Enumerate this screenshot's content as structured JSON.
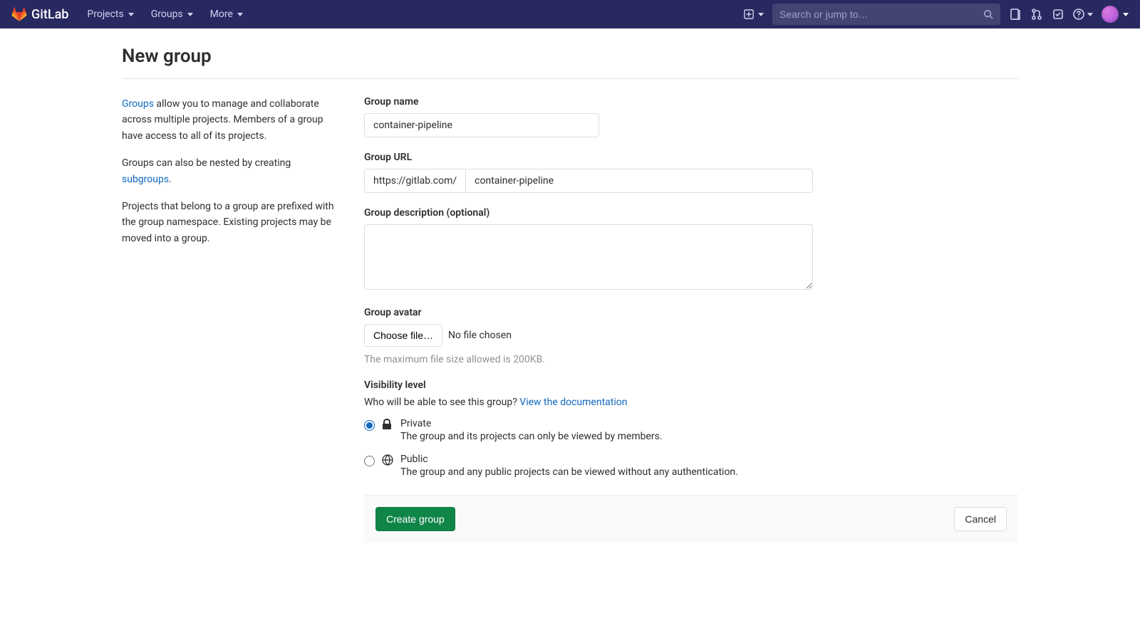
{
  "brand": {
    "name": "GitLab"
  },
  "nav": {
    "projects": "Projects",
    "groups": "Groups",
    "more": "More",
    "search_placeholder": "Search or jump to…"
  },
  "page": {
    "title": "New group"
  },
  "info": {
    "p1_link": "Groups",
    "p1_rest": " allow you to manage and collaborate across multiple projects. Members of a group have access to all of its projects.",
    "p2_prefix": "Groups can also be nested by creating ",
    "p2_link": "subgroups",
    "p2_suffix": ".",
    "p3": "Projects that belong to a group are prefixed with the group namespace. Existing projects may be moved into a group."
  },
  "form": {
    "name_label": "Group name",
    "name_value": "container-pipeline",
    "url_label": "Group URL",
    "url_prefix": "https://gitlab.com/",
    "url_value": "container-pipeline",
    "desc_label": "Group description (optional)",
    "desc_value": "",
    "avatar_label": "Group avatar",
    "choose_file": "Choose file…",
    "no_file": "No file chosen",
    "max_size": "The maximum file size allowed is 200KB.",
    "visibility_label": "Visibility level",
    "visibility_q": "Who will be able to see this group? ",
    "visibility_doc": "View the documentation",
    "private_title": "Private",
    "private_desc": "The group and its projects can only be viewed by members.",
    "public_title": "Public",
    "public_desc": "The group and any public projects can be viewed without any authentication.",
    "submit": "Create group",
    "cancel": "Cancel"
  }
}
